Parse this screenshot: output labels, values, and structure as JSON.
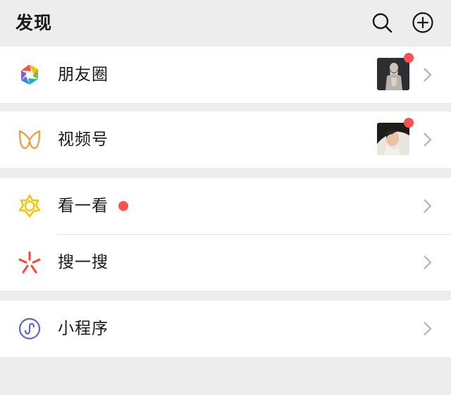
{
  "header": {
    "title": "发现",
    "search_icon": "search-icon",
    "add_icon": "add-circle-icon"
  },
  "items": [
    {
      "label": "朋友圈",
      "icon": "moments-aperture-icon",
      "badge": "thumbnail-with-red-dot"
    },
    {
      "label": "视频号",
      "icon": "channels-butterfly-icon",
      "badge": "thumbnail-with-red-dot"
    },
    {
      "label": "看一看",
      "icon": "top-stories-icon",
      "badge": "red-dot"
    },
    {
      "label": "搜一搜",
      "icon": "search-spark-icon",
      "badge": ""
    },
    {
      "label": "小程序",
      "icon": "mini-program-icon",
      "badge": ""
    }
  ],
  "colors": {
    "background": "#ededed",
    "cell": "#ffffff",
    "badge_red": "#fa5151",
    "chevron": "#b2b2b2",
    "top_stories_yellow": "#f5c400",
    "search_red": "#f04a3a",
    "mini_program_purple": "#6467c9",
    "channels_orange": "#e8a24a"
  }
}
